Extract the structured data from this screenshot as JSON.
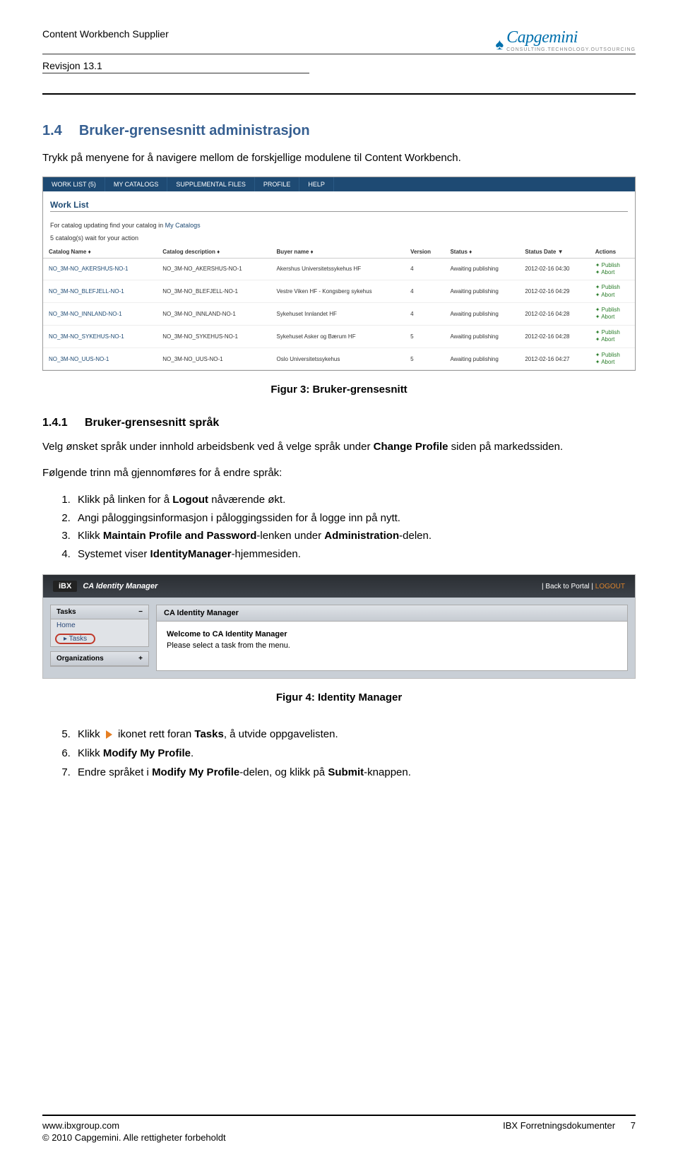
{
  "header": {
    "title": "Content Workbench Supplier",
    "revision": "Revisjon 13.1",
    "logo_text": "Capgemini",
    "logo_sub": "CONSULTING.TECHNOLOGY.OUTSOURCING"
  },
  "section": {
    "num": "1.4",
    "title": "Bruker-grensesnitt administrasjon",
    "intro": "Trykk på menyene for å navigere mellom de forskjellige modulene til Content Workbench."
  },
  "screenshot1": {
    "menubar": [
      "WORK LIST (5)",
      "MY CATALOGS",
      "SUPPLEMENTAL FILES",
      "PROFILE",
      "HELP"
    ],
    "title": "Work List",
    "subtitle_pre": "For catalog updating find your catalog in ",
    "subtitle_link": "My Catalogs",
    "count": "5 catalog(s) wait for your action",
    "columns": [
      "Catalog Name ♦",
      "Catalog description ♦",
      "Buyer name ♦",
      "Version",
      "Status ♦",
      "Status Date ▼",
      "Actions"
    ],
    "rows": [
      {
        "name": "NO_3M-NO_AKERSHUS-NO-1",
        "desc": "NO_3M-NO_AKERSHUS-NO-1",
        "buyer": "Akershus Universitetssykehus HF",
        "ver": "4",
        "status": "Awaiting publishing",
        "date": "2012-02-16 04:30",
        "act1": "Publish",
        "act2": "Abort"
      },
      {
        "name": "NO_3M-NO_BLEFJELL-NO-1",
        "desc": "NO_3M-NO_BLEFJELL-NO-1",
        "buyer": "Vestre Viken HF - Kongsberg sykehus",
        "ver": "4",
        "status": "Awaiting publishing",
        "date": "2012-02-16 04:29",
        "act1": "Publish",
        "act2": "Abort"
      },
      {
        "name": "NO_3M-NO_INNLAND-NO-1",
        "desc": "NO_3M-NO_INNLAND-NO-1",
        "buyer": "Sykehuset Innlandet HF",
        "ver": "4",
        "status": "Awaiting publishing",
        "date": "2012-02-16 04:28",
        "act1": "Publish",
        "act2": "Abort"
      },
      {
        "name": "NO_3M-NO_SYKEHUS-NO-1",
        "desc": "NO_3M-NO_SYKEHUS-NO-1",
        "buyer": "Sykehuset Asker og Bærum HF",
        "ver": "5",
        "status": "Awaiting publishing",
        "date": "2012-02-16 04:28",
        "act1": "Publish",
        "act2": "Abort"
      },
      {
        "name": "NO_3M-NO_UUS-NO-1",
        "desc": "NO_3M-NO_UUS-NO-1",
        "buyer": "Oslo Universitetssykehus",
        "ver": "5",
        "status": "Awaiting publishing",
        "date": "2012-02-16 04:27",
        "act1": "Publish",
        "act2": "Abort"
      }
    ]
  },
  "caption1": "Figur 3: Bruker-grensesnitt",
  "subsection": {
    "num": "1.4.1",
    "title": "Bruker-grensesnitt språk",
    "p1_pre": "Velg ønsket språk under innhold arbeidsbenk ved å velge språk under ",
    "p1_bold": "Change Profile",
    "p1_post": " siden på markedssiden.",
    "p2": "Følgende trinn må gjennomføres for å endre språk:"
  },
  "steps1": [
    {
      "pre": "Klikk på linken for å ",
      "b": "Logout",
      "post": "  nåværende økt."
    },
    {
      "pre": "Angi påloggingsinformasjon i påloggingssiden for å logge inn på nytt.",
      "b": "",
      "post": ""
    },
    {
      "pre": "Klikk ",
      "b": "Maintain Profile and Password",
      "post": "-lenken under ",
      "b2": "Administration",
      "post2": "-delen."
    },
    {
      "pre": "Systemet viser ",
      "b": "IdentityManager",
      "post": "-hjemmesiden."
    }
  ],
  "screenshot2": {
    "brand_ibx": "iBX",
    "brand_suffix": "CA Identity Manager",
    "back": "| Back to Portal |",
    "logout": "LOGOUT",
    "side_tasks": "Tasks",
    "side_home": "Home",
    "side_tasks_item": "Tasks",
    "side_org": "Organizations",
    "main_header": "CA Identity Manager",
    "main_welcome": "Welcome to CA Identity Manager",
    "main_sub": "Please select a task from the menu."
  },
  "caption2": "Figur 4: Identity Manager",
  "steps2": [
    {
      "n": "5.",
      "pre": "Klikk ",
      "post": " ikonet rett foran ",
      "b": "Tasks",
      "post2": ", å utvide oppgavelisten."
    },
    {
      "n": "6.",
      "pre": "Klikk ",
      "b": "Modify My Profile",
      "post": "."
    },
    {
      "n": "7.",
      "pre": "Endre språket i ",
      "b": "Modify My Profile",
      "post": "-delen, og klikk på ",
      "b2": "Submit",
      "post2": "-knappen."
    }
  ],
  "footer": {
    "url": "www.ibxgroup.com",
    "doc": "IBX Forretningsdokumenter",
    "page": "7",
    "copy": "© 2010 Capgemini. Alle rettigheter forbeholdt"
  }
}
